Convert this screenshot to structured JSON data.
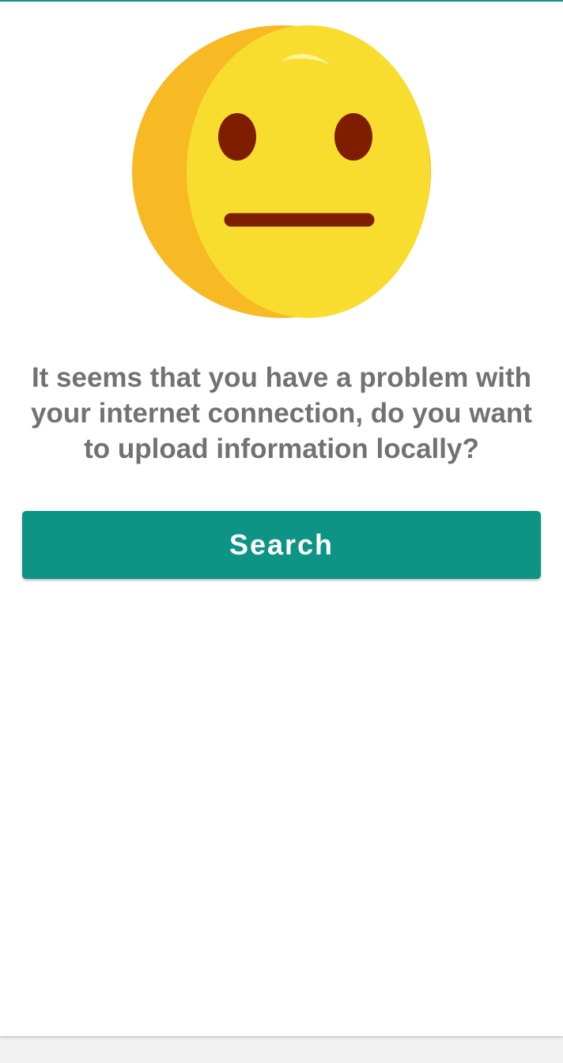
{
  "emoji": {
    "icon": "neutral-face-icon",
    "colors": {
      "face": "#f8dd2e",
      "shade": "#f7b924",
      "features": "#7f1d00",
      "highlight": "#fff59b"
    }
  },
  "message": "It seems that you have a problem with your internet connection, do you want to upload information locally?",
  "search_button": {
    "label": "Search"
  },
  "colors": {
    "accent": "#0e9484",
    "text": "#727272"
  }
}
